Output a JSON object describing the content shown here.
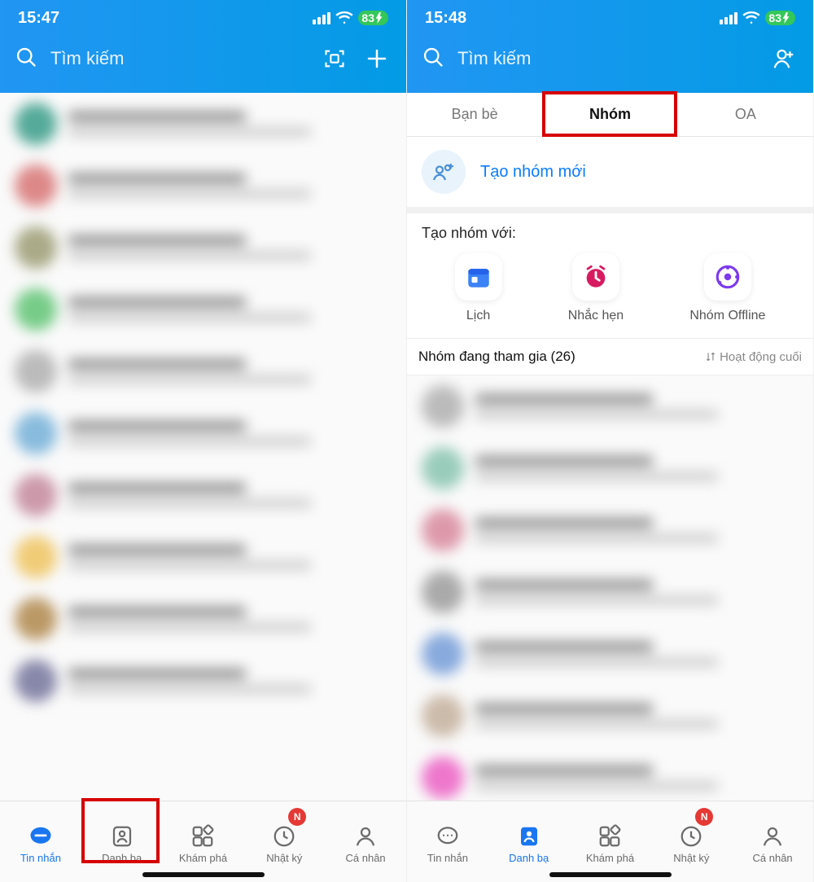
{
  "left": {
    "status": {
      "time": "15:47",
      "battery": "83"
    },
    "search": {
      "placeholder": "Tìm kiếm"
    },
    "nav": {
      "items": [
        "Tin nhắn",
        "Danh bạ",
        "Khám phá",
        "Nhật ký",
        "Cá nhân"
      ],
      "active_index": 0,
      "highlight_index": 1,
      "badge": {
        "index": 3,
        "text": "N"
      }
    }
  },
  "right": {
    "status": {
      "time": "15:48",
      "battery": "83"
    },
    "search": {
      "placeholder": "Tìm kiếm"
    },
    "tabs": {
      "items": [
        "Bạn bè",
        "Nhóm",
        "OA"
      ],
      "active_index": 1
    },
    "create": {
      "label": "Tạo nhóm mới"
    },
    "create_with": {
      "title": "Tạo nhóm với:",
      "options": [
        "Lịch",
        "Nhắc hẹn",
        "Nhóm Offline"
      ]
    },
    "groups": {
      "label": "Nhóm đang tham gia (26)",
      "sort": "Hoạt động cuối"
    },
    "nav": {
      "items": [
        "Tin nhắn",
        "Danh bạ",
        "Khám phá",
        "Nhật ký",
        "Cá nhân"
      ],
      "active_index": 1,
      "badge": {
        "index": 3,
        "text": "N"
      }
    }
  }
}
